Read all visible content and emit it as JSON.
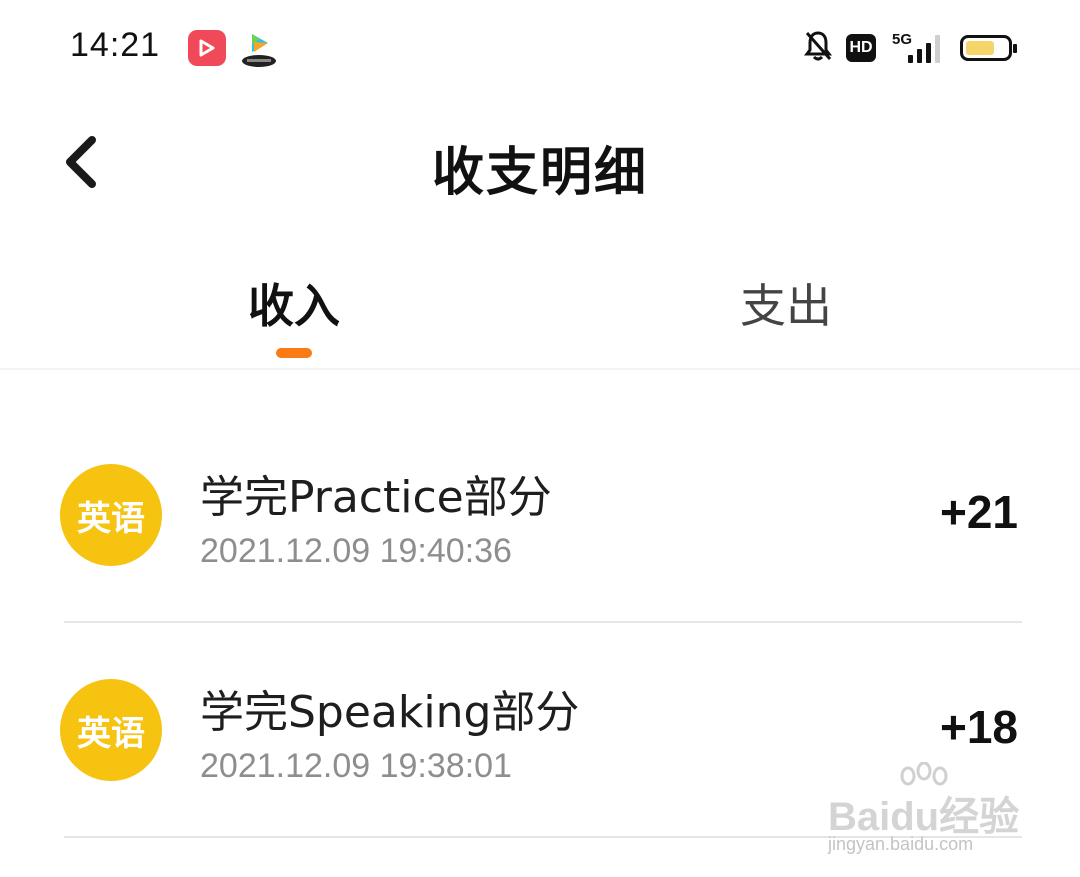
{
  "status_bar": {
    "time": "14:21",
    "network": "5G",
    "hd": "HD",
    "battery_level": 0.7,
    "icons": [
      "video-app-icon",
      "tv-app-icon",
      "bell-muted-icon",
      "hd-icon",
      "signal-icon",
      "battery-icon"
    ]
  },
  "header": {
    "title": "收支明细",
    "back_icon": "chevron-left-icon"
  },
  "tabs": [
    {
      "label": "收入",
      "active": true
    },
    {
      "label": "支出",
      "active": false
    }
  ],
  "colors": {
    "accent": "#fa7a14",
    "avatar": "#f6c311"
  },
  "transactions": [
    {
      "subject": "英语",
      "title": "学完Practice部分",
      "time": "2021.12.09 19:40:36",
      "amount": "+21"
    },
    {
      "subject": "英语",
      "title": "学完Speaking部分",
      "time": "2021.12.09 19:38:01",
      "amount": "+18"
    }
  ],
  "watermark": {
    "brand": "Baidu经验",
    "url": "jingyan.baidu.com"
  }
}
